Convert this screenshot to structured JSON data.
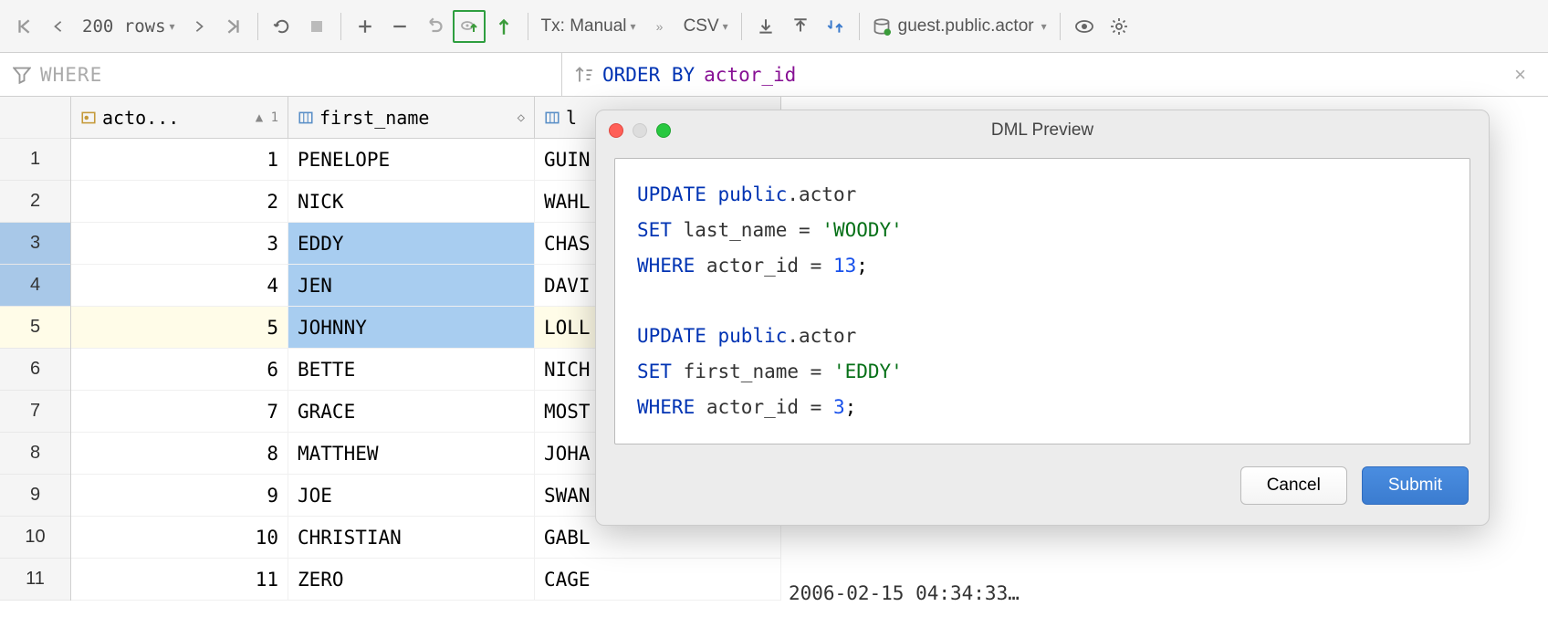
{
  "toolbar": {
    "rows_label": "200 rows",
    "tx_label": "Tx: Manual",
    "format_label": "CSV",
    "datasource_label": "guest.public.actor"
  },
  "filter": {
    "where_label": "WHERE",
    "order_by_label": "ORDER BY",
    "order_by_col": "actor_id"
  },
  "columns": {
    "id": "acto...",
    "id_sort": "1",
    "first_name": "first_name",
    "last_name_short": "l"
  },
  "rows": [
    {
      "n": "1",
      "id": "1",
      "fn": "PENELOPE",
      "ln": "GUIN"
    },
    {
      "n": "2",
      "id": "2",
      "fn": "NICK",
      "ln": "WAHL"
    },
    {
      "n": "3",
      "id": "3",
      "fn": "EDDY",
      "ln": "CHAS"
    },
    {
      "n": "4",
      "id": "4",
      "fn": "JEN",
      "ln": "DAVI"
    },
    {
      "n": "5",
      "id": "5",
      "fn": "JOHNNY",
      "ln": "LOLL"
    },
    {
      "n": "6",
      "id": "6",
      "fn": "BETTE",
      "ln": "NICH"
    },
    {
      "n": "7",
      "id": "7",
      "fn": "GRACE",
      "ln": "MOST"
    },
    {
      "n": "8",
      "id": "8",
      "fn": "MATTHEW",
      "ln": "JOHA"
    },
    {
      "n": "9",
      "id": "9",
      "fn": "JOE",
      "ln": "SWAN"
    },
    {
      "n": "10",
      "id": "10",
      "fn": "CHRISTIAN",
      "ln": "GABL"
    },
    {
      "n": "11",
      "id": "11",
      "fn": "ZERO",
      "ln": "CAGE"
    }
  ],
  "timestamp_cell": "2006-02-15 04:34:33…",
  "dialog": {
    "title": "DML Preview",
    "sql": {
      "l1_kw": "UPDATE",
      "l1_schema": "public",
      "l1_tbl": ".actor",
      "l2_kw": "SET",
      "l2_col": "last_name = ",
      "l2_val": "'WOODY'",
      "l3_kw": "WHERE",
      "l3_col": "actor_id = ",
      "l3_val": "13",
      "l4_kw": "UPDATE",
      "l4_schema": "public",
      "l4_tbl": ".actor",
      "l5_kw": "SET",
      "l5_col": "first_name = ",
      "l5_val": "'EDDY'",
      "l6_kw": "WHERE",
      "l6_col": "actor_id = ",
      "l6_val": "3"
    },
    "cancel": "Cancel",
    "submit": "Submit"
  }
}
